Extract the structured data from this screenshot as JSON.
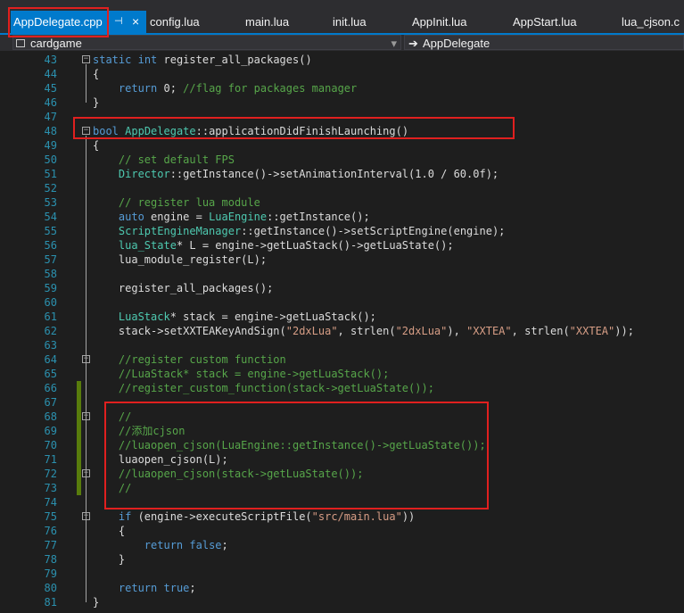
{
  "tabs": [
    {
      "label": "AppDelegate.cpp",
      "active": true,
      "pin": "⊣",
      "close": "×"
    },
    {
      "label": "config.lua"
    },
    {
      "label": "main.lua"
    },
    {
      "label": "init.lua"
    },
    {
      "label": "AppInit.lua"
    },
    {
      "label": "AppStart.lua"
    },
    {
      "label": "lua_cjson.c"
    }
  ],
  "nav": {
    "project": "cardgame",
    "scope": "AppDelegate",
    "dropdown_arrow": "▾",
    "scope_arrow": "➔"
  },
  "fold_glyph": "−",
  "lines": [
    {
      "n": "43",
      "fold": true,
      "tokens": [
        [
          "k",
          "static"
        ],
        [
          "p",
          " "
        ],
        [
          "k",
          "int"
        ],
        [
          "p",
          " register_all_packages()"
        ]
      ]
    },
    {
      "n": "44",
      "tokens": [
        [
          "p",
          "{"
        ]
      ]
    },
    {
      "n": "45",
      "tokens": [
        [
          "p",
          "    "
        ],
        [
          "k",
          "return"
        ],
        [
          "p",
          " 0; "
        ],
        [
          "c",
          "//flag for packages manager"
        ]
      ]
    },
    {
      "n": "46",
      "tokens": [
        [
          "p",
          "}"
        ]
      ]
    },
    {
      "n": "47",
      "tokens": []
    },
    {
      "n": "48",
      "fold": true,
      "tokens": [
        [
          "k",
          "bool"
        ],
        [
          "p",
          " "
        ],
        [
          "t",
          "AppDelegate"
        ],
        [
          "p",
          "::applicationDidFinishLaunching()"
        ]
      ]
    },
    {
      "n": "49",
      "tokens": [
        [
          "p",
          "{"
        ]
      ]
    },
    {
      "n": "50",
      "tokens": [
        [
          "p",
          "    "
        ],
        [
          "c",
          "// set default FPS"
        ]
      ]
    },
    {
      "n": "51",
      "tokens": [
        [
          "p",
          "    "
        ],
        [
          "t",
          "Director"
        ],
        [
          "p",
          "::getInstance()->setAnimationInterval(1.0 / 60.0f);"
        ]
      ]
    },
    {
      "n": "52",
      "tokens": []
    },
    {
      "n": "53",
      "tokens": [
        [
          "p",
          "    "
        ],
        [
          "c",
          "// register lua module"
        ]
      ]
    },
    {
      "n": "54",
      "tokens": [
        [
          "p",
          "    "
        ],
        [
          "k",
          "auto"
        ],
        [
          "p",
          " engine = "
        ],
        [
          "t",
          "LuaEngine"
        ],
        [
          "p",
          "::getInstance();"
        ]
      ]
    },
    {
      "n": "55",
      "tokens": [
        [
          "p",
          "    "
        ],
        [
          "t",
          "ScriptEngineManager"
        ],
        [
          "p",
          "::getInstance()->setScriptEngine(engine);"
        ]
      ]
    },
    {
      "n": "56",
      "tokens": [
        [
          "p",
          "    "
        ],
        [
          "t",
          "lua_State"
        ],
        [
          "p",
          "* L = engine->getLuaStack()->getLuaState();"
        ]
      ]
    },
    {
      "n": "57",
      "tokens": [
        [
          "p",
          "    lua_module_register(L);"
        ]
      ]
    },
    {
      "n": "58",
      "tokens": []
    },
    {
      "n": "59",
      "tokens": [
        [
          "p",
          "    register_all_packages();"
        ]
      ]
    },
    {
      "n": "60",
      "tokens": []
    },
    {
      "n": "61",
      "tokens": [
        [
          "p",
          "    "
        ],
        [
          "t",
          "LuaStack"
        ],
        [
          "p",
          "* stack = engine->getLuaStack();"
        ]
      ]
    },
    {
      "n": "62",
      "tokens": [
        [
          "p",
          "    stack->setXXTEAKeyAndSign("
        ],
        [
          "s",
          "\"2dxLua\""
        ],
        [
          "p",
          ", strlen("
        ],
        [
          "s",
          "\"2dxLua\""
        ],
        [
          "p",
          "), "
        ],
        [
          "s",
          "\"XXTEA\""
        ],
        [
          "p",
          ", strlen("
        ],
        [
          "s",
          "\"XXTEA\""
        ],
        [
          "p",
          "));"
        ]
      ]
    },
    {
      "n": "63",
      "tokens": []
    },
    {
      "n": "64",
      "fold": true,
      "tokens": [
        [
          "p",
          "    "
        ],
        [
          "c",
          "//register custom function"
        ]
      ]
    },
    {
      "n": "65",
      "tokens": [
        [
          "p",
          "    "
        ],
        [
          "c",
          "//LuaStack* stack = engine->getLuaStack();"
        ]
      ]
    },
    {
      "n": "66",
      "changed": true,
      "tokens": [
        [
          "p",
          "    "
        ],
        [
          "c",
          "//register_custom_function(stack->getLuaState());"
        ]
      ]
    },
    {
      "n": "67",
      "changed": true,
      "tokens": []
    },
    {
      "n": "68",
      "changed": true,
      "fold": true,
      "tokens": [
        [
          "p",
          "    "
        ],
        [
          "c",
          "//"
        ]
      ]
    },
    {
      "n": "69",
      "changed": true,
      "tokens": [
        [
          "p",
          "    "
        ],
        [
          "c",
          "//添加cjson"
        ]
      ]
    },
    {
      "n": "70",
      "changed": true,
      "tokens": [
        [
          "p",
          "    "
        ],
        [
          "c",
          "//luaopen_cjson(LuaEngine::getInstance()->getLuaState());"
        ]
      ]
    },
    {
      "n": "71",
      "changed": true,
      "tokens": [
        [
          "p",
          "    luaopen_cjson(L);"
        ]
      ]
    },
    {
      "n": "72",
      "changed": true,
      "fold": true,
      "tokens": [
        [
          "p",
          "    "
        ],
        [
          "c",
          "//luaopen_cjson(stack->getLuaState());"
        ]
      ]
    },
    {
      "n": "73",
      "changed": true,
      "tokens": [
        [
          "p",
          "    "
        ],
        [
          "c",
          "//"
        ]
      ]
    },
    {
      "n": "74",
      "tokens": []
    },
    {
      "n": "75",
      "fold": true,
      "tokens": [
        [
          "p",
          "    "
        ],
        [
          "k",
          "if"
        ],
        [
          "p",
          " (engine->executeScriptFile("
        ],
        [
          "s",
          "\"src/main.lua\""
        ],
        [
          "p",
          "))"
        ]
      ]
    },
    {
      "n": "76",
      "tokens": [
        [
          "p",
          "    {"
        ]
      ]
    },
    {
      "n": "77",
      "tokens": [
        [
          "p",
          "        "
        ],
        [
          "k",
          "return"
        ],
        [
          "p",
          " "
        ],
        [
          "k",
          "false"
        ],
        [
          "p",
          ";"
        ]
      ]
    },
    {
      "n": "78",
      "tokens": [
        [
          "p",
          "    }"
        ]
      ]
    },
    {
      "n": "79",
      "tokens": []
    },
    {
      "n": "80",
      "tokens": [
        [
          "p",
          "    "
        ],
        [
          "k",
          "return"
        ],
        [
          "p",
          " "
        ],
        [
          "k",
          "true"
        ],
        [
          "p",
          ";"
        ]
      ]
    },
    {
      "n": "81",
      "tokens": [
        [
          "p",
          "}"
        ]
      ]
    }
  ],
  "colors": {
    "accent": "#007acc",
    "highlight_box": "#e0201f",
    "keyword": "#569cd6",
    "type": "#4ec9b0",
    "comment": "#57a64a",
    "string": "#d69d85",
    "line_number": "#2b91af",
    "change_marker": "#587c0c"
  }
}
